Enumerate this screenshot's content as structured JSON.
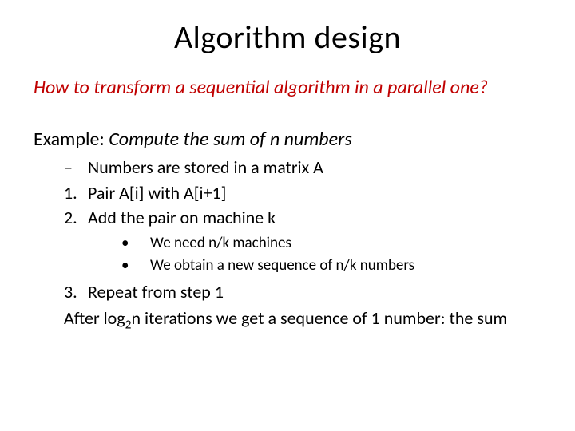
{
  "title": "Algorithm design",
  "question": "How to transform a sequential algorithm in a parallel one?",
  "example": {
    "label": "Example: ",
    "desc": "Compute the sum of n numbers"
  },
  "level1": {
    "dash_marker": "–",
    "item_a": "Numbers are stored in a matrix A",
    "num1": "1.",
    "item_1": "Pair A[i] with A[i+1]",
    "num2": "2.",
    "item_2": "Add the pair on machine k"
  },
  "level2": {
    "bullet": "•",
    "item_a": "We need n/k machines",
    "item_b": "We obtain a new sequence of n/k numbers"
  },
  "closing": {
    "num3": "3.",
    "item_3": "Repeat from step 1",
    "after_a": "After log",
    "sub": "2",
    "after_b": "n iterations we get a sequence of 1 number: the sum"
  }
}
